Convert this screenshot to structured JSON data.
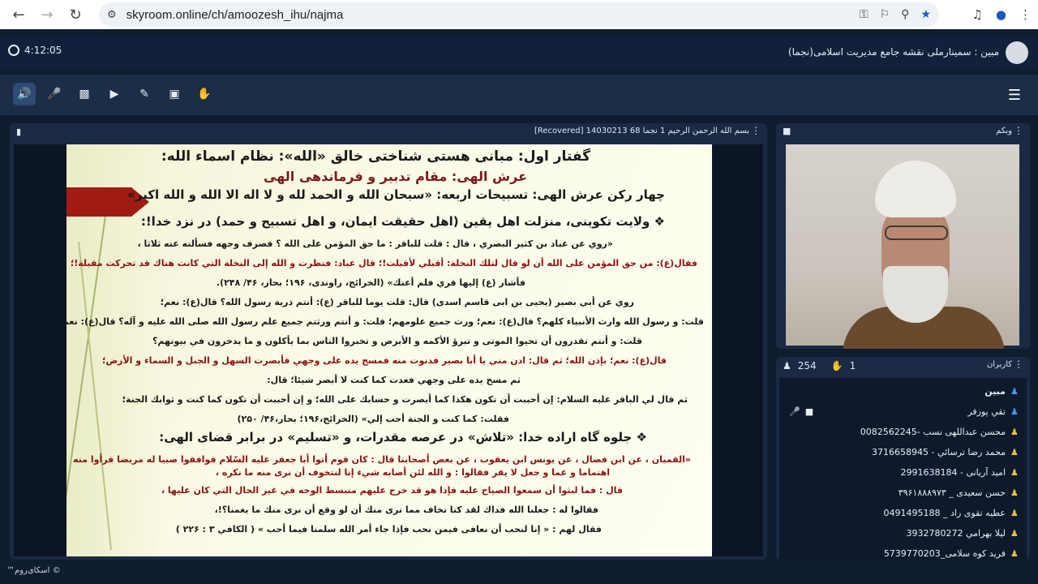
{
  "browser": {
    "url": "skyroom.online/ch/amoozesh_ihu/najma"
  },
  "room": {
    "timer": "4:12:05",
    "title": "مبین : سمینارملی نقشه جامع مدیریت اسلامی(نجما)"
  },
  "presentation": {
    "title": "بسم الله الرحمن الرحیم 1 نجما 68 14030213 [Recovered]",
    "lines": [
      "گفتار اول: مبانی هستی شناختی خالق «الله»: نظام اسماء الله:",
      "عرش الهی: مقام تدبیر و فرماندهی الهی",
      "چهار رکن عرش الهی: تسبیحات اربعه: «سبحان الله و الحمد لله و لا اله الا الله و الله اکبر»",
      "❖ ولایت تکوینی، منزلت اهل یقین (اهل حقیقت ایمان، و اهل تسبیح و حمد) در نزد خدا!:",
      "«روي عن عباد بن كثير البصري ، قال : قلت للباقر : ما حق المؤمن على الله ؟ فصرف وجهه فسألته عنه ثلاثا ،",
      "فقال(ع): من حق المؤمن على الله أن لو قال لتلك النخلة: أقبلي لأقبلت!؛ قال عباد: فنظرت و الله إلى النخلة التي كانت هناك قد تحركت مقبلة!؛",
      "فأشار (ع) إليها قري فلم أعنك» (الخرائج، راوندی، ۱۹۶؛ بحار، ۴۶/ ۲۴۸).",
      "روي عن أبي بصير (یحیی بن ابی قاسم اسدی) قال: قلت يوما للباقر (ع): أنتم ذرية رسول الله؟ قال(ع): نعم؛",
      "قلت: و رسول الله وارث الأنبياء كلهم؟ قال(ع): نعم؛ ورث جميع علومهم؛ قلت: و أنتم ورثتم جميع علم رسول الله صلى الله عليه و آله؟ قال(ع): نعم؛",
      "قلت: و أنتم تقدرون أن تحيوا الموتى و تبرؤ الأكمه و الأبرص و تخبروا الناس بما يأكلون و ما يدخرون في بيوتهم؟",
      "قال(ع): نعم؛ بإذن الله؛ ثم قال: ادن مني يا أبا بصير فدنوت منه فمسح يده على وجهي فأبصرت السهل و الجبل و السماء و الأرض؛",
      "ثم مسح يده على وجهي فعدت كما كنت لا أبصر شيئا؛ قال:",
      "ثم قال لي الباقر عليه السلام: إن أحببت أن تكون هكذا كما أبصرت و حسابك على الله؛ و إن أحببت أن تكون كما كنت و ثوابك الجنة؛",
      "فقلت: كما كنت و الجنة أحب إلي» (الخرائج،۱۹۶؛ بحار،۴۶/ ۲۵۰)",
      "❖ جلوه گاه اراده خدا: «تلاش» در عرصه مقدرات، و «تسلیم» در برابر قضای الهی:",
      "«القميان ، عن ابن فضال ، عن يونس ابن يعقوب ، عن بعض أصحابنا قال : كان قوم أتوا أبا جعفر عليه السّلام فوافقوا صبيا له مريضا فرأوا منه",
      "اهتماما و غما و جعل لا يقر فقالوا : و الله لئن أصابه شيء إنا لنتخوف أن نرى منه ما نكره ،",
      "قال : فما لبثوا أن سمعوا الصياح عليه فإذا هو قد خرج عليهم منبسط الوجه في غير الحال التي كان عليها ،",
      "فقالوا له : جعلنا الله فداك لقد كنا نخاف مما نرى منك أن لو وقع أن نرى منك ما يغمنا؟!،",
      "فقال لهم : « إنا لنحب أن نعافى فيمن نحب فإذا جاء أمر الله سلمنا فيما أحب » ( الكافي ۳ : ۲۲۶ )"
    ]
  },
  "webcam": {
    "title": "وبکم"
  },
  "users": {
    "title": "کاربران",
    "total": "254",
    "hands": "1",
    "list": [
      "مبین",
      "تقي پورفر",
      "محسن عبداللهی نسب -0082562245",
      "محمد رضا ترسائي - 3716658945",
      "امید آریانی - 2991638184",
      "حسن سعیدی _ ۳۹۶۱۸۸۸۹۷۳",
      "عطیه تقوی راد _ 0491495188",
      "لیلا بهرامي 3932780272",
      "فرید کوه سلامی_5739770203"
    ]
  },
  "footer": {
    "brand": "© اسکای‌روم™"
  },
  "colors": {
    "accent": "#3e9bff",
    "panel": "#1a2a43",
    "background": "#0f1d2e"
  }
}
